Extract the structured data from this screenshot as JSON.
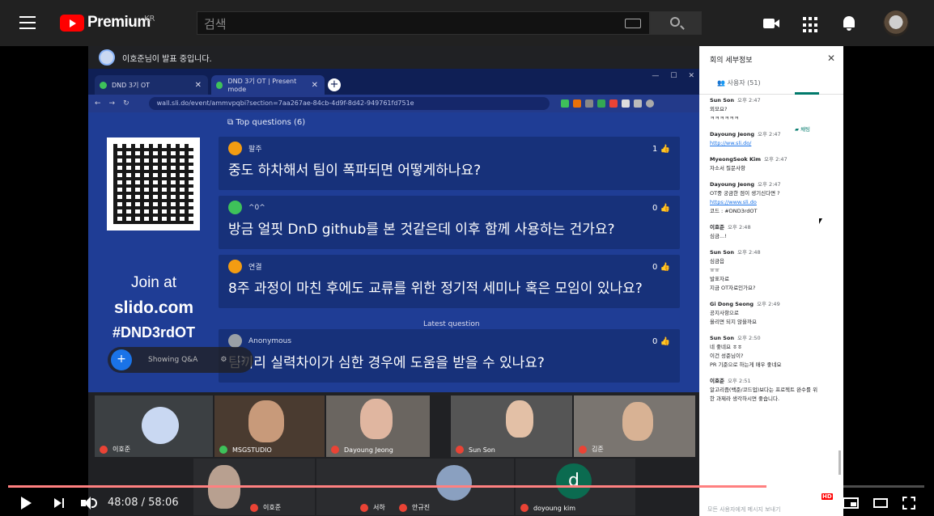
{
  "header": {
    "brand": "Premium",
    "region": "KR",
    "search_placeholder": "검색"
  },
  "meet": {
    "presenting_text": "이호준님이 발표 중입니다."
  },
  "browser": {
    "tabs": [
      {
        "label": "DND 3기 OT"
      },
      {
        "label": "DND 3기 OT | Present mode"
      }
    ],
    "url": "wall.sli.do/event/ammvpqbi?section=7aa267ae-84cb-4d9f-8d42-949761fd751e"
  },
  "slido": {
    "top_questions_label": "Top questions (6)",
    "join_line1": "Join at",
    "join_line2": "slido.com",
    "join_line3": "#DND3rdOT",
    "latest_label": "Latest question",
    "showing_label": "Showing Q&A",
    "questions": [
      {
        "author": "팔주",
        "likes": "1",
        "text": "중도 하차해서 팀이 폭파되면 어떻게하나요?",
        "color": "#f39c12"
      },
      {
        "author": "^0^",
        "likes": "0",
        "text": "방금 얼핏 DnD github를 본 것같은데 이후 함께 사용하는 건가요?",
        "color": "#3ec15a"
      },
      {
        "author": "연결",
        "likes": "0",
        "text": "8주 과정이 마친 후에도 교류를 위한 정기적 세미나 혹은 모임이 있나요?",
        "color": "#f39c12"
      },
      {
        "author": "Anonymous",
        "likes": "0",
        "text": "팀끼리 실력차이가 심한 경우에 도움을 받을 수 있나요?",
        "color": "#9aa0a6"
      }
    ]
  },
  "participants": [
    {
      "name": "이호준"
    },
    {
      "name": "MSGSTUDIO"
    },
    {
      "name": "Dayoung Jeong"
    },
    {
      "name": "Sun Son"
    },
    {
      "name": "김준"
    },
    {
      "name": "이호준"
    },
    {
      "name": "서하"
    },
    {
      "name": "안규진"
    },
    {
      "name": "doyoung kim"
    }
  ],
  "side_panel": {
    "title": "회의 세부정보",
    "people_tab": "사용자 (51)",
    "chat_tab": "채팅",
    "footer": "모든 사용자에게 메시지 보내기",
    "messages": [
      {
        "author": "Sun Son",
        "time": "오후 2:47",
        "lines": [
          "외모요?",
          "ㅋㅋㅋㅋㅋㅋ"
        ]
      },
      {
        "author": "Dayoung Jeong",
        "time": "오후 2:47",
        "lines": [
          "http://ww.sli.do/"
        ]
      },
      {
        "author": "MyeongSeok Kim",
        "time": "오후 2:47",
        "lines": [
          "자소서 질문사항"
        ]
      },
      {
        "author": "Dayoung Jeong",
        "time": "오후 2:47",
        "lines": [
          "OT중 궁금한 점이 생기신다면 ?",
          "https://www.sli.do",
          "코드 : #DND3rdOT"
        ]
      },
      {
        "author": "이호준",
        "time": "오후 2:48",
        "lines": [
          "심금...!"
        ]
      },
      {
        "author": "Sun Son",
        "time": "오후 2:48",
        "lines": [
          "심금읍",
          "ㅠㅠ",
          "발표자료",
          "지금 OT자료인가요?"
        ]
      },
      {
        "author": "Gi Dong Seong",
        "time": "오후 2:49",
        "lines": [
          "공지사항으로",
          "올리면 되지 않을까요"
        ]
      },
      {
        "author": "Sun Son",
        "time": "오후 2:50",
        "lines": [
          "네 좋네요 ㅎㅎ",
          "이건 성준님이?",
          "PR 기준으로 하는게 매우 좋네요"
        ]
      },
      {
        "author": "이호준",
        "time": "오후 2:51",
        "lines": [
          "알고리즘(백준/코드업)보다는 프로젝트 완수를 위",
          "한 과제라 생각하시면 좋습니다."
        ]
      }
    ]
  },
  "controls": {
    "time_current": "48:08",
    "time_sep": " / ",
    "time_total": "58:06",
    "hd_badge": "HD",
    "played_fraction": 0.828,
    "loaded_fraction": 0.84
  },
  "colors": {
    "accent": "#ff0000",
    "slido_bg": "#1f3d95",
    "meet_chat": "#00796b"
  }
}
